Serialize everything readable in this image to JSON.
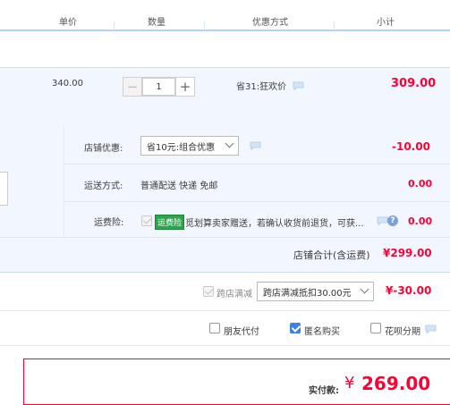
{
  "header": {
    "unit_price": "单价",
    "quantity": "数量",
    "discount_method": "优惠方式",
    "subtotal": "小计"
  },
  "item": {
    "unit_price": "340.00",
    "quantity": "1",
    "discount": "省31:狂欢价",
    "subtotal": "309.00"
  },
  "shop": {
    "shop_discount_label": "店铺优惠:",
    "shop_discount_value": "省10元:组合优惠",
    "shop_discount_amount": "-10.00",
    "shipping_label": "运送方式:",
    "shipping_value": "普通配送 快递 免邮",
    "shipping_amount": "0.00",
    "insurance_label": "运费险:",
    "insurance_tag": "运费险",
    "insurance_text": "觅划算卖家赠送，若确认收货前退货，可获...",
    "insurance_amount": "0.00",
    "shop_total_label": "店铺合计(含运费)",
    "shop_total_amount": "¥299.00"
  },
  "cross_store": {
    "label": "跨店满减",
    "select_value": "跨店满减抵扣30.00元",
    "amount": "¥-30.00"
  },
  "options": {
    "friend_pay": "朋友代付",
    "anonymous": "匿名购买",
    "huabei": "花呗分期"
  },
  "total": {
    "label": "实付款:",
    "currency": "¥",
    "amount": "269.00"
  },
  "colors": {
    "accent_red": "#ff0036",
    "accent_blue": "#3d7ee8",
    "panel_bg": "#f2f7ff",
    "tag_green": "#2fa54b"
  },
  "icons": [
    "chat-bubble-icon",
    "question-icon",
    "chevron-down-icon",
    "checkbox-icon",
    "minus-icon",
    "plus-icon"
  ]
}
